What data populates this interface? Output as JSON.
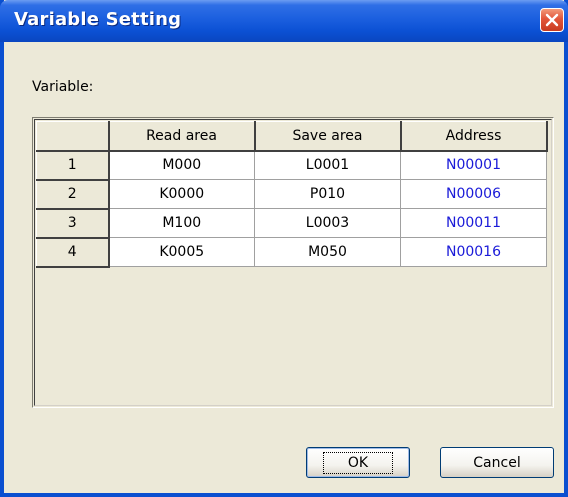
{
  "window": {
    "title": "Variable Setting"
  },
  "label": "Variable:",
  "table": {
    "headers": [
      "",
      "Read area",
      "Save area",
      "Address"
    ],
    "rows": [
      {
        "index": "1",
        "read": "M000",
        "save": "L0001",
        "address": "N00001"
      },
      {
        "index": "2",
        "read": "K0000",
        "save": "P010",
        "address": "N00006"
      },
      {
        "index": "3",
        "read": "M100",
        "save": "L0003",
        "address": "N00011"
      },
      {
        "index": "4",
        "read": "K0005",
        "save": "M050",
        "address": "N00016"
      }
    ]
  },
  "buttons": {
    "ok": "OK",
    "cancel": "Cancel"
  },
  "colors": {
    "address_text": "#1a1ad8",
    "titlebar": "#0b50d3",
    "close": "#e2553a"
  }
}
